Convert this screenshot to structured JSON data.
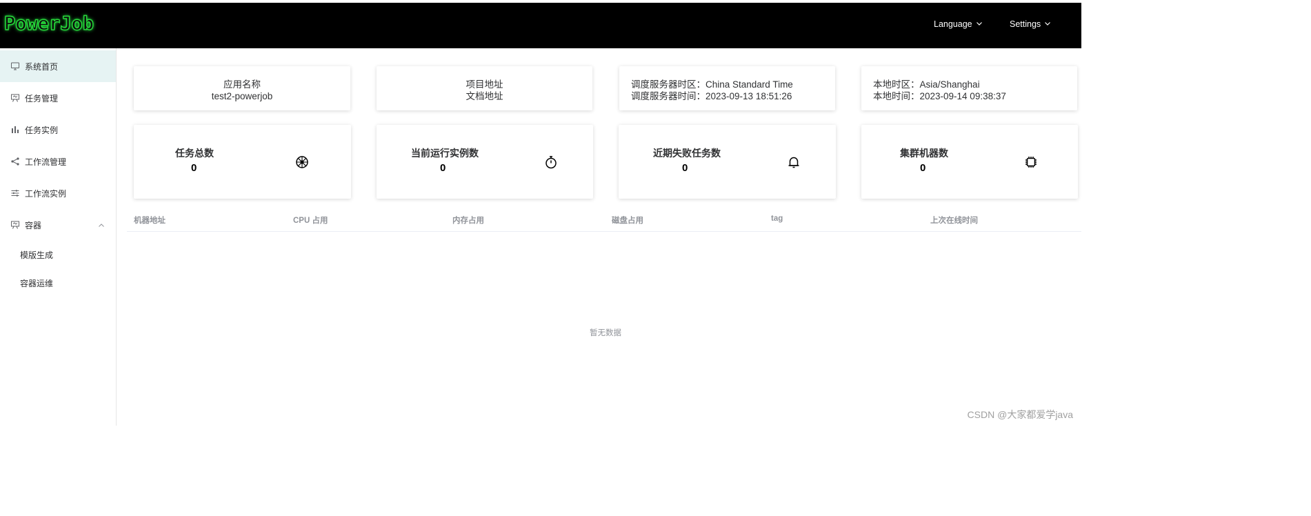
{
  "header": {
    "logo_text": "PowerJob",
    "language_label": "Language",
    "settings_label": "Settings"
  },
  "sidebar": {
    "items": [
      {
        "label": "系统首页",
        "icon": "monitor-icon"
      },
      {
        "label": "任务管理",
        "icon": "presentation-icon"
      },
      {
        "label": "任务实例",
        "icon": "bar-chart-icon"
      },
      {
        "label": "工作流管理",
        "icon": "share-icon"
      },
      {
        "label": "工作流实例",
        "icon": "sliders-icon"
      },
      {
        "label": "容器",
        "icon": "presentation-icon"
      }
    ],
    "subitems": [
      {
        "label": "模版生成"
      },
      {
        "label": "容器运维"
      }
    ]
  },
  "info": {
    "app_name_label": "应用名称",
    "app_name_value": "test2-powerjob",
    "project_label": "项目地址",
    "doc_label": "文档地址",
    "server_tz_line": "调度服务器时区：China Standard Time",
    "server_time_line": "调度服务器时间：2023-09-13 18:51:26",
    "local_tz_line": "本地时区：Asia/Shanghai",
    "local_time_line": "本地时间：2023-09-14 09:38:37"
  },
  "stats": [
    {
      "title": "任务总数",
      "value": "0",
      "icon": "dharma-wheel-icon"
    },
    {
      "title": "当前运行实例数",
      "value": "0",
      "icon": "stopwatch-icon"
    },
    {
      "title": "近期失败任务数",
      "value": "0",
      "icon": "bell-icon"
    },
    {
      "title": "集群机器数",
      "value": "0",
      "icon": "chip-icon"
    }
  ],
  "table": {
    "columns": [
      "机器地址",
      "CPU 占用",
      "内存占用",
      "磁盘占用",
      "tag",
      "上次在线时间"
    ],
    "empty_text": "暂无数据"
  },
  "watermark": "CSDN @大家都爱学java",
  "colors": {
    "header_bg": "#000000",
    "logo_green": "#27d83a",
    "active_item_bg": "#e6f3f3"
  }
}
